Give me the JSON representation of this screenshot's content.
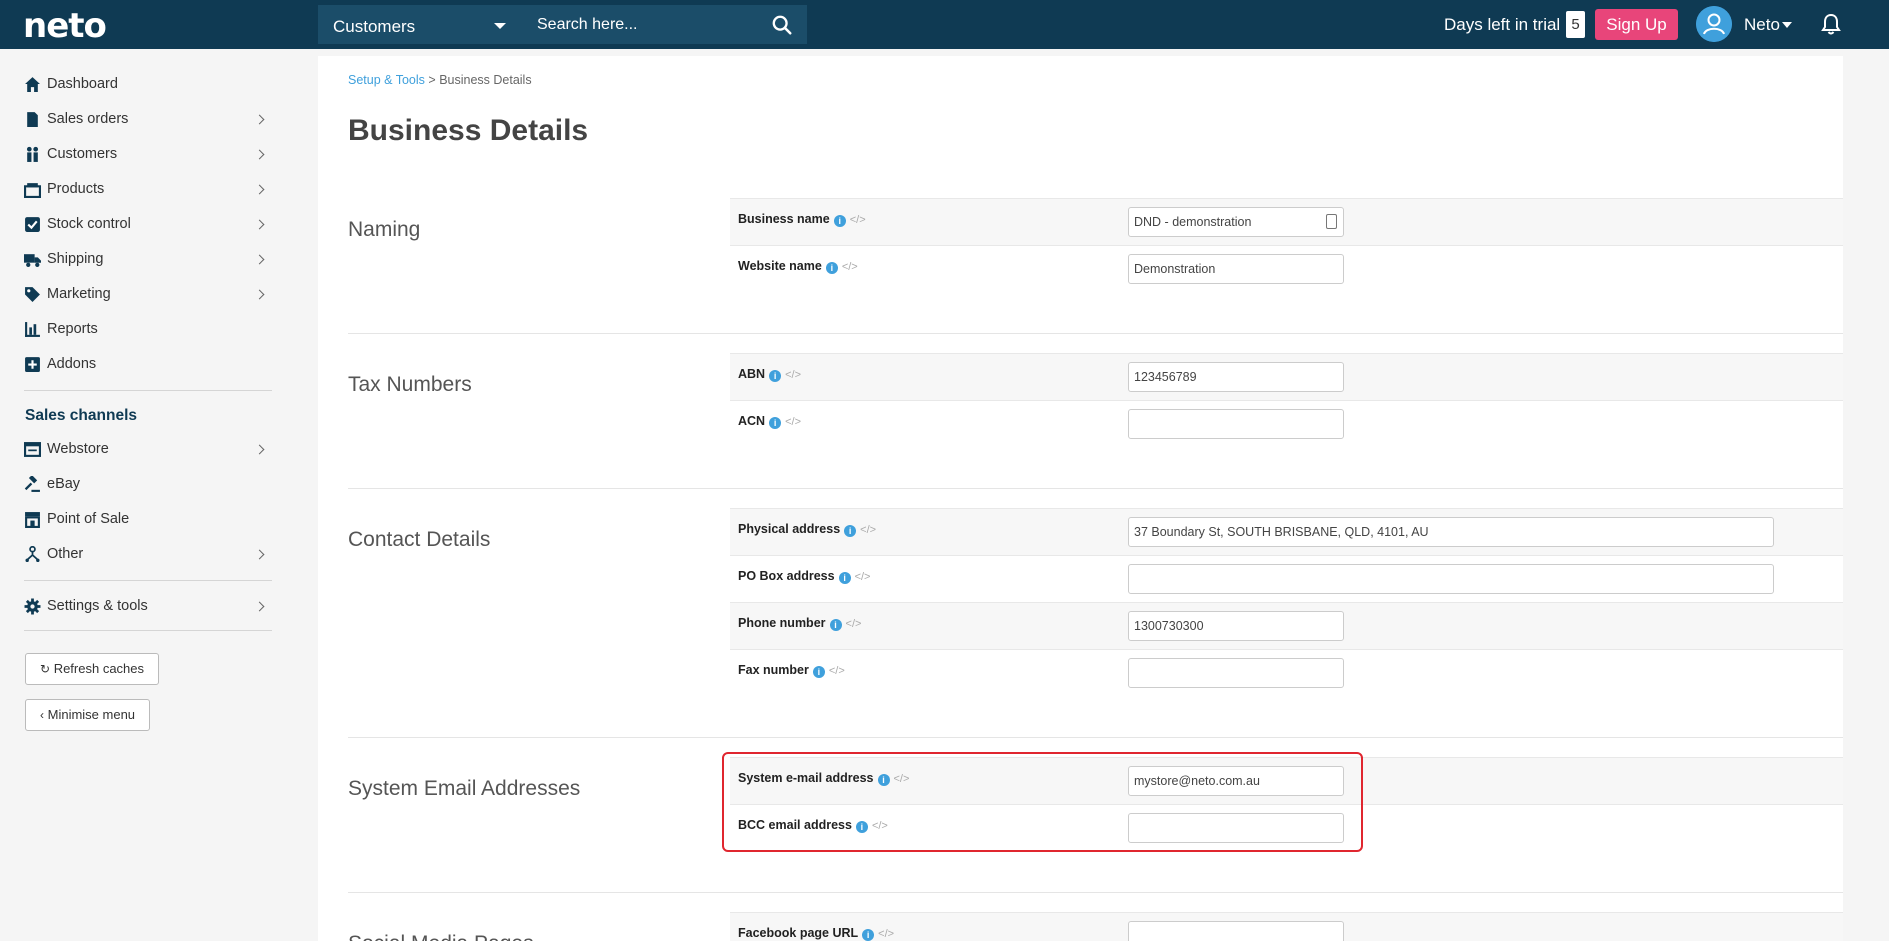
{
  "topbar": {
    "logo": "neto",
    "module": "Customers",
    "search_placeholder": "Search here...",
    "trial_label": "Days left in trial",
    "trial_days": "5",
    "signup_label": "Sign Up",
    "user_name": "Neto"
  },
  "sidebar": {
    "items": [
      {
        "label": "Dashboard"
      },
      {
        "label": "Sales orders"
      },
      {
        "label": "Customers"
      },
      {
        "label": "Products"
      },
      {
        "label": "Stock control"
      },
      {
        "label": "Shipping"
      },
      {
        "label": "Marketing"
      },
      {
        "label": "Reports"
      },
      {
        "label": "Addons"
      }
    ],
    "channels_heading": "Sales channels",
    "channels": [
      {
        "label": "Webstore"
      },
      {
        "label": "eBay"
      },
      {
        "label": "Point of Sale"
      },
      {
        "label": "Other"
      }
    ],
    "settings_label": "Settings & tools",
    "refresh_label": "Refresh caches",
    "minimise_label": "Minimise menu"
  },
  "breadcrumb": {
    "parent": "Setup & Tools",
    "separator": ">",
    "current": "Business Details"
  },
  "page_title": "Business Details",
  "sections": [
    {
      "title": "Naming",
      "fields": [
        {
          "label": "Business name",
          "value": "DND - demonstration"
        },
        {
          "label": "Website name",
          "value": "Demonstration"
        }
      ]
    },
    {
      "title": "Tax Numbers",
      "fields": [
        {
          "label": "ABN",
          "value": "123456789"
        },
        {
          "label": "ACN",
          "value": ""
        }
      ]
    },
    {
      "title": "Contact Details",
      "fields": [
        {
          "label": "Physical address",
          "value": "37 Boundary St, SOUTH BRISBANE, QLD, 4101, AU"
        },
        {
          "label": "PO Box address",
          "value": ""
        },
        {
          "label": "Phone number",
          "value": "1300730300"
        },
        {
          "label": "Fax number",
          "value": ""
        }
      ]
    },
    {
      "title": "System Email Addresses",
      "fields": [
        {
          "label": "System e-mail address",
          "value": "mystore@neto.com.au"
        },
        {
          "label": "BCC email address",
          "value": ""
        }
      ]
    },
    {
      "title": "Social Media Pages",
      "fields": [
        {
          "label": "Facebook page URL",
          "value": ""
        }
      ]
    }
  ],
  "colors": {
    "topbar": "#0f3a53",
    "accent": "#3fa0dc",
    "signup": "#e8457a",
    "highlight": "#e0262f"
  }
}
